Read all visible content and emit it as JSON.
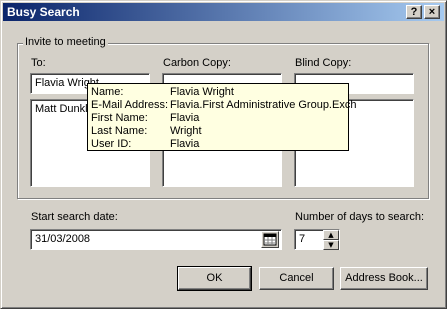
{
  "window": {
    "title": "Busy Search",
    "help_button": "?",
    "close_button": "×"
  },
  "group": {
    "legend": "Invite to meeting",
    "to_label": "To:",
    "cc_label": "Carbon Copy:",
    "bcc_label": "Blind Copy:",
    "to_input_value": "Flavia Wright",
    "cc_input_value": "",
    "bcc_input_value": "",
    "to_list": [
      "Matt Dunkley"
    ],
    "cc_list": [],
    "bcc_list": []
  },
  "tooltip": {
    "rows": [
      {
        "key": "Name:",
        "value": "Flavia Wright"
      },
      {
        "key": "E-Mail Address:",
        "value": "Flavia.First Administrative Group.Exch"
      },
      {
        "key": "First Name:",
        "value": "Flavia"
      },
      {
        "key": "Last Name:",
        "value": "Wright"
      },
      {
        "key": "User ID:",
        "value": "Flavia"
      }
    ]
  },
  "search": {
    "start_date_label": "Start search date:",
    "start_date_value": "31/03/2008",
    "days_label": "Number of days to search:",
    "days_value": "7"
  },
  "buttons": {
    "ok": "OK",
    "cancel": "Cancel",
    "address_book": "Address Book..."
  },
  "colors": {
    "title_start": "#0a246a",
    "title_end": "#a6caf0",
    "tooltip_bg": "#ffffe1",
    "face": "#d4d0c8"
  }
}
